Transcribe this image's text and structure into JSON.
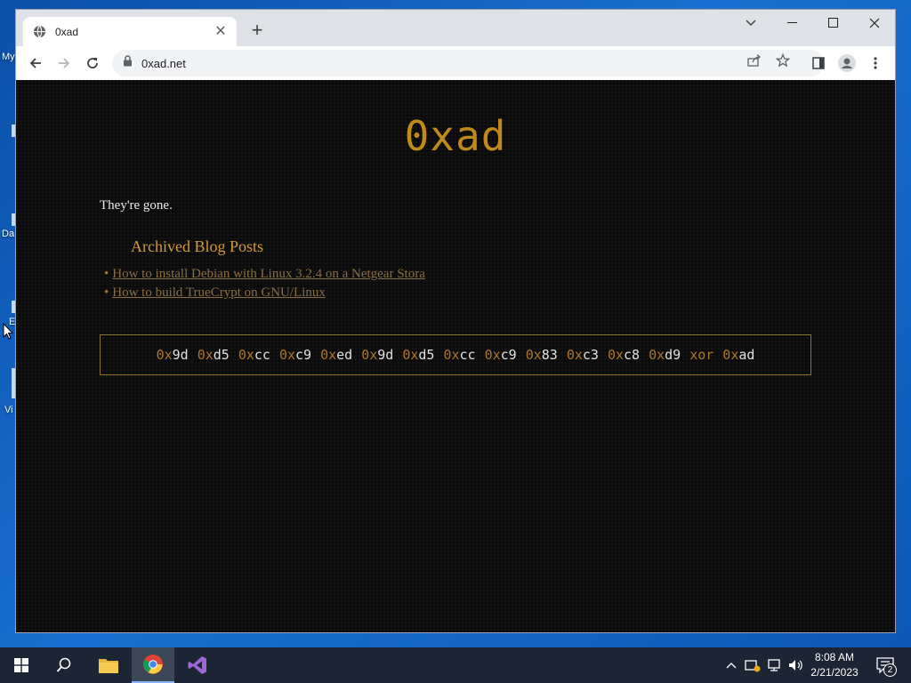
{
  "desktop": {
    "labels": [
      "My",
      "Da",
      "E",
      "Vi"
    ]
  },
  "browser": {
    "tab_title": "0xad",
    "url": "0xad.net"
  },
  "page": {
    "site_title": "0xad",
    "intro": "They're gone.",
    "archive_heading": "Archived Blog Posts",
    "posts": [
      {
        "bullet": "•",
        "title": "How to install Debian with Linux 3.2.4 on a Netgear Stora"
      },
      {
        "bullet": "•",
        "title": "How to build TrueCrypt on GNU/Linux"
      }
    ],
    "xor_tokens": [
      {
        "prefix": "0x",
        "value": "9d"
      },
      {
        "prefix": "0x",
        "value": "d5"
      },
      {
        "prefix": "0x",
        "value": "cc"
      },
      {
        "prefix": "0x",
        "value": "c9"
      },
      {
        "prefix": "0x",
        "value": "ed"
      },
      {
        "prefix": "0x",
        "value": "9d"
      },
      {
        "prefix": "0x",
        "value": "d5"
      },
      {
        "prefix": "0x",
        "value": "cc"
      },
      {
        "prefix": "0x",
        "value": "c9"
      },
      {
        "prefix": "0x",
        "value": "83"
      },
      {
        "prefix": "0x",
        "value": "c3"
      },
      {
        "prefix": "0x",
        "value": "c8"
      },
      {
        "prefix": "0x",
        "value": "d9"
      }
    ],
    "xor_operator": "xor",
    "xor_key": {
      "prefix": "0x",
      "value": "ad"
    }
  },
  "taskbar": {
    "clock_time": "8:08 AM",
    "clock_date": "2/21/2023",
    "notification_count": "2"
  },
  "colors": {
    "accent": "#c08a1a",
    "page_bg": "#0b0b0b",
    "link": "#8a6d44"
  }
}
